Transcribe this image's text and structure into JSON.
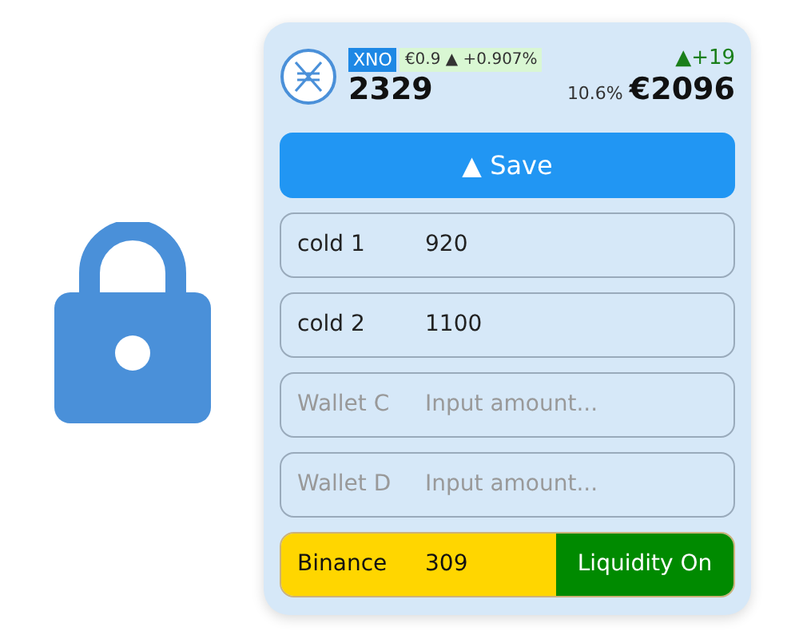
{
  "header": {
    "ticker": "XNO",
    "price": "€0.9",
    "change_arrow": "▲",
    "change": "+0.907%",
    "balance": "2329",
    "delta_arrow": "▲",
    "delta": "+19",
    "share": "10.6%",
    "value": "€2096"
  },
  "save_button": {
    "arrow": "▲",
    "label": "Save"
  },
  "wallets": [
    {
      "label": "cold 1",
      "value": "920"
    },
    {
      "label": "cold 2",
      "value": "1100"
    },
    {
      "label": "Wallet C",
      "placeholder": "Input amount..."
    },
    {
      "label": "Wallet D",
      "placeholder": "Input amount..."
    }
  ],
  "exchange": {
    "label": "Binance",
    "value": "309",
    "toggle_label": "Liquidity On",
    "on": true
  }
}
